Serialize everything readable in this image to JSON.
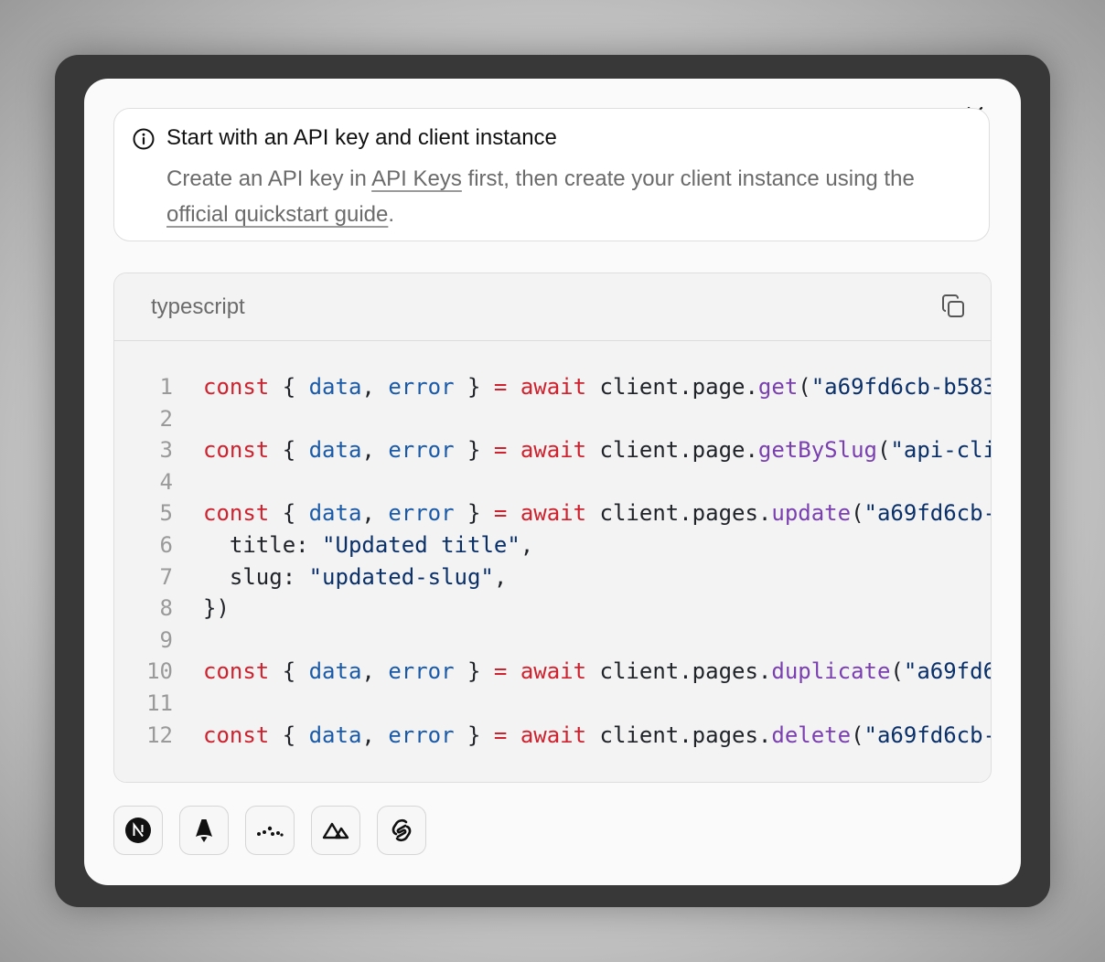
{
  "callout": {
    "icon": "info-icon",
    "title": "Start with an API key and client instance",
    "desc_pre": "Create an API key in ",
    "link_api_keys": "API Keys",
    "desc_mid": " first, then create your client instance using the ",
    "link_quickstart": "official quickstart guide",
    "desc_post": "."
  },
  "code": {
    "language": "typescript",
    "copy_icon": "copy-icon",
    "lines": [
      {
        "num": "1",
        "text": "const { data, error } = await client.page.get(\"a69fd6cb-b583"
      },
      {
        "num": "2",
        "text": ""
      },
      {
        "num": "3",
        "text": "const { data, error } = await client.page.getBySlug(\"api-cli"
      },
      {
        "num": "4",
        "text": ""
      },
      {
        "num": "5",
        "text": "const { data, error } = await client.pages.update(\"a69fd6cb-"
      },
      {
        "num": "6",
        "text": "  title: \"Updated title\","
      },
      {
        "num": "7",
        "text": "  slug: \"updated-slug\","
      },
      {
        "num": "8",
        "text": "})"
      },
      {
        "num": "9",
        "text": ""
      },
      {
        "num": "10",
        "text": "const { data, error } = await client.pages.duplicate(\"a69fd6"
      },
      {
        "num": "11",
        "text": ""
      },
      {
        "num": "12",
        "text": "const { data, error } = await client.pages.delete(\"a69fd6cb-"
      }
    ]
  },
  "frameworks": [
    {
      "name": "nextjs-icon"
    },
    {
      "name": "astro-icon"
    },
    {
      "name": "remix-icon"
    },
    {
      "name": "nuxt-icon"
    },
    {
      "name": "svelte-icon"
    }
  ],
  "close_icon": "close-icon",
  "colors": {
    "keyword": "#cf222e",
    "variable": "#1a5aa8",
    "function": "#7a3fb0",
    "string": "#0a3069"
  }
}
